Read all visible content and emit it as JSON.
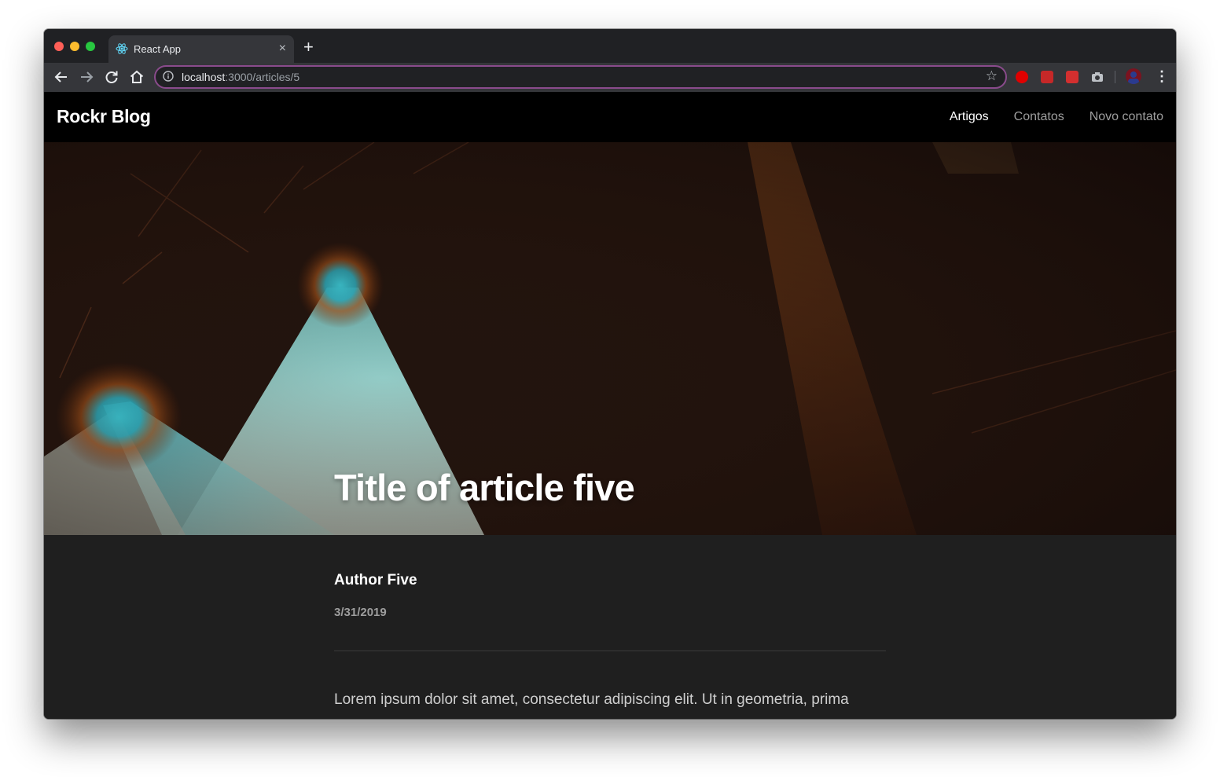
{
  "browser": {
    "tab": {
      "title": "React App",
      "close": "×"
    },
    "new_tab": "+",
    "address": {
      "host": "localhost",
      "path": ":3000/articles/5"
    }
  },
  "site": {
    "brand": "Rockr Blog",
    "nav": [
      {
        "label": "Artigos",
        "active": true
      },
      {
        "label": "Contatos",
        "active": false
      },
      {
        "label": "Novo contato",
        "active": false
      }
    ]
  },
  "article": {
    "title": "Title of article five",
    "author": "Author Five",
    "date": "3/31/2019",
    "body": "Lorem ipsum dolor sit amet, consectetur adipiscing elit. Ut in geometria, prima"
  },
  "colors": {
    "page_bg": "#1f1f1f",
    "header_bg": "#000000",
    "nav_active": "#ffffff",
    "nav_inactive": "#9e9e9e",
    "omnibox_border": "#8a4b8c"
  },
  "icons": {
    "back": "arrow-left-icon",
    "forward": "arrow-right-icon",
    "reload": "reload-icon",
    "home": "home-icon",
    "info": "info-icon",
    "star": "star-icon",
    "menu": "kebab-menu-icon"
  }
}
